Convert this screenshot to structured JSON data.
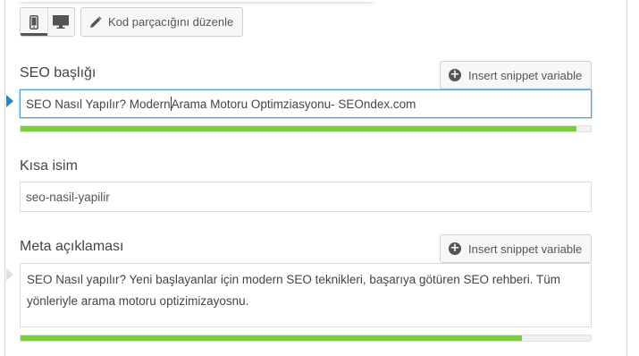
{
  "toolbar": {
    "mobile_icon": "mobile-icon",
    "desktop_icon": "desktop-icon",
    "edit_snippet_label": "Kod parçacığını düzenle",
    "edit_icon": "pencil-icon"
  },
  "seo_title": {
    "label": "SEO başlığı",
    "insert_label": "Insert snippet variable",
    "value_before_caret": "SEO Nasıl Yapılır? Modern",
    "value_after_caret": " Arama Motoru Optimziasyonu- SEOndex.com",
    "progress": 0.975
  },
  "slug": {
    "label": "Kısa isim",
    "value": "seo-nasil-yapilir"
  },
  "meta_description": {
    "label": "Meta açıklaması",
    "insert_label": "Insert snippet variable",
    "value": "SEO Nasıl yapılır? Yeni başlayanlar için modern SEO teknikleri, başarıya götüren SEO rehberi. Tüm yönleriyle arama motoru optizimizayosnu.",
    "progress": 0.88
  },
  "colors": {
    "accent": "#1e8cbe",
    "progress_good": "#7ad03a",
    "focus_border": "#5b9dd9"
  }
}
